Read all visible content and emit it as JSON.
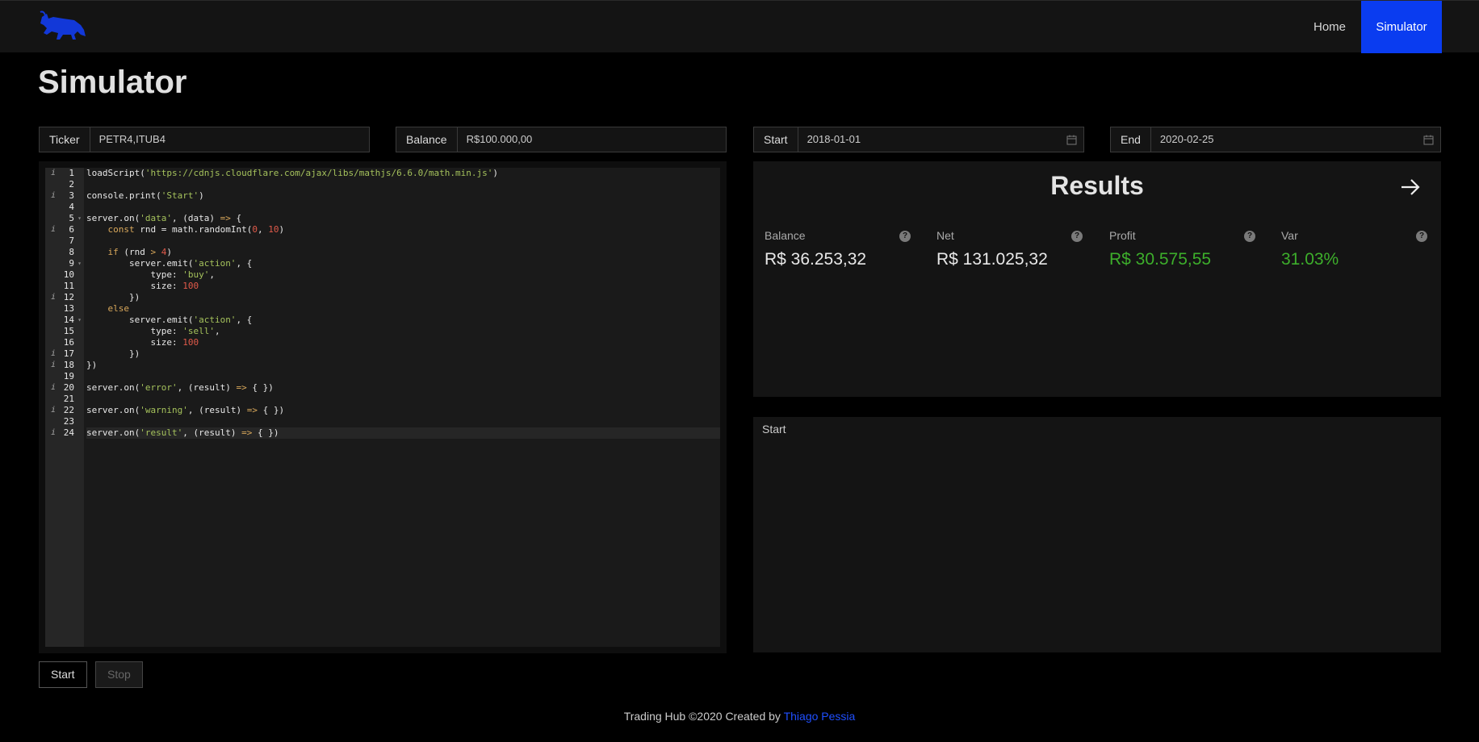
{
  "header": {
    "logo": "bull-logo",
    "nav": [
      {
        "label": "Home"
      },
      {
        "label": "Simulator",
        "active": true
      }
    ],
    "active_color": "#0a3cf0"
  },
  "page_title": "Simulator",
  "inputs": {
    "ticker": {
      "label": "Ticker",
      "value": "PETR4,ITUB4"
    },
    "balance": {
      "label": "Balance",
      "value": "R$100.000,00"
    },
    "start": {
      "label": "Start",
      "value": "2018-01-01"
    },
    "end": {
      "label": "End",
      "value": "2020-02-25"
    }
  },
  "editor": {
    "lines": [
      {
        "n": "1",
        "info": true,
        "fold": false
      },
      {
        "n": "2",
        "info": false,
        "fold": false
      },
      {
        "n": "3",
        "info": true,
        "fold": false
      },
      {
        "n": "4",
        "info": false,
        "fold": false
      },
      {
        "n": "5",
        "info": false,
        "fold": true
      },
      {
        "n": "6",
        "info": true,
        "fold": false
      },
      {
        "n": "7",
        "info": false,
        "fold": false
      },
      {
        "n": "8",
        "info": false,
        "fold": false
      },
      {
        "n": "9",
        "info": false,
        "fold": true
      },
      {
        "n": "10",
        "info": false,
        "fold": false
      },
      {
        "n": "11",
        "info": false,
        "fold": false
      },
      {
        "n": "12",
        "info": true,
        "fold": false
      },
      {
        "n": "13",
        "info": false,
        "fold": false
      },
      {
        "n": "14",
        "info": false,
        "fold": true
      },
      {
        "n": "15",
        "info": false,
        "fold": false
      },
      {
        "n": "16",
        "info": false,
        "fold": false
      },
      {
        "n": "17",
        "info": true,
        "fold": false
      },
      {
        "n": "18",
        "info": true,
        "fold": false
      },
      {
        "n": "19",
        "info": false,
        "fold": false
      },
      {
        "n": "20",
        "info": true,
        "fold": false
      },
      {
        "n": "21",
        "info": false,
        "fold": false
      },
      {
        "n": "22",
        "info": true,
        "fold": false
      },
      {
        "n": "23",
        "info": false,
        "fold": false
      },
      {
        "n": "24",
        "info": true,
        "fold": false
      }
    ],
    "info_glyph": "i",
    "fold_glyph": "▾",
    "code": [
      [
        [
          "t",
          "loadScript("
        ],
        [
          "s",
          "'https://cdnjs.cloudflare.com/ajax/libs/mathjs/6.6.0/math.min.js'"
        ],
        [
          "t",
          ")"
        ]
      ],
      [],
      [
        [
          "t",
          "console.print("
        ],
        [
          "s",
          "'Start'"
        ],
        [
          "t",
          ")"
        ]
      ],
      [],
      [
        [
          "t",
          "server.on("
        ],
        [
          "s",
          "'data'"
        ],
        [
          "t",
          ", (data) "
        ],
        [
          "k",
          "=>"
        ],
        [
          "t",
          " {"
        ]
      ],
      [
        [
          "t",
          "    "
        ],
        [
          "k",
          "const"
        ],
        [
          "t",
          " rnd = math.randomInt("
        ],
        [
          "n",
          "0"
        ],
        [
          "t",
          ", "
        ],
        [
          "n",
          "10"
        ],
        [
          "t",
          ")"
        ]
      ],
      [],
      [
        [
          "t",
          "    "
        ],
        [
          "k",
          "if"
        ],
        [
          "t",
          " (rnd "
        ],
        [
          "k",
          ">"
        ],
        [
          "t",
          " "
        ],
        [
          "n",
          "4"
        ],
        [
          "t",
          ")"
        ]
      ],
      [
        [
          "t",
          "        server.emit("
        ],
        [
          "s",
          "'action'"
        ],
        [
          "t",
          ", {"
        ]
      ],
      [
        [
          "t",
          "            type: "
        ],
        [
          "s",
          "'buy'"
        ],
        [
          "t",
          ","
        ]
      ],
      [
        [
          "t",
          "            size: "
        ],
        [
          "n",
          "100"
        ]
      ],
      [
        [
          "t",
          "        })"
        ]
      ],
      [
        [
          "t",
          "    "
        ],
        [
          "k",
          "else"
        ]
      ],
      [
        [
          "t",
          "        server.emit("
        ],
        [
          "s",
          "'action'"
        ],
        [
          "t",
          ", {"
        ]
      ],
      [
        [
          "t",
          "            type: "
        ],
        [
          "s",
          "'sell'"
        ],
        [
          "t",
          ","
        ]
      ],
      [
        [
          "t",
          "            size: "
        ],
        [
          "n",
          "100"
        ]
      ],
      [
        [
          "t",
          "        })"
        ]
      ],
      [
        [
          "t",
          "})"
        ]
      ],
      [],
      [
        [
          "t",
          "server.on("
        ],
        [
          "s",
          "'error'"
        ],
        [
          "t",
          ", (result) "
        ],
        [
          "k",
          "=>"
        ],
        [
          "t",
          " { })"
        ]
      ],
      [],
      [
        [
          "t",
          "server.on("
        ],
        [
          "s",
          "'warning'"
        ],
        [
          "t",
          ", (result) "
        ],
        [
          "k",
          "=>"
        ],
        [
          "t",
          " { })"
        ]
      ],
      [],
      [
        [
          "t",
          "server.on("
        ],
        [
          "s",
          "'result'"
        ],
        [
          "t",
          ", (result) "
        ],
        [
          "k",
          "=>"
        ],
        [
          "t",
          " { })"
        ]
      ]
    ],
    "active_line": 23
  },
  "results": {
    "title": "Results",
    "stats": [
      {
        "label": "Balance",
        "value": "R$ 36.253,32",
        "positive": false
      },
      {
        "label": "Net",
        "value": "R$ 131.025,32",
        "positive": false
      },
      {
        "label": "Profit",
        "value": "R$ 30.575,55",
        "positive": true
      },
      {
        "label": "Var",
        "value": "31.03%",
        "positive": true
      }
    ],
    "help_glyph": "?",
    "positive_color": "#3dae2b"
  },
  "console": {
    "text": "Start"
  },
  "buttons": {
    "start": "Start",
    "stop": "Stop"
  },
  "footer": {
    "text": "Trading Hub ©2020 Created by ",
    "author": "Thiago Pessia"
  }
}
